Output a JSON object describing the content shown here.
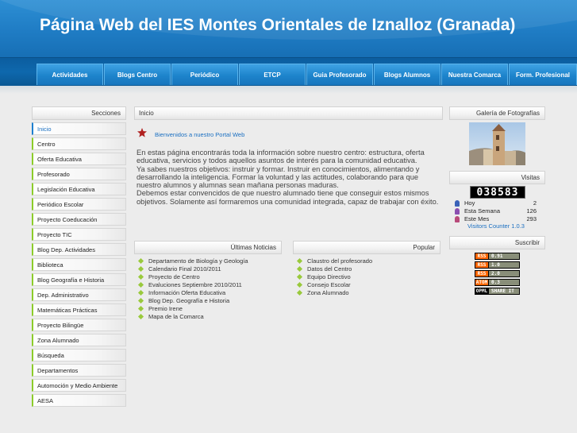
{
  "header": {
    "title": "Página Web del IES Montes Orientales de Iznalloz (Granada)"
  },
  "nav": [
    "Actividades",
    "Blogs Centro",
    "Periódico",
    "ETCP",
    "Guia Profesorado",
    "Blogs Alumnos",
    "Nuestra Comarca",
    "Form. Profesional"
  ],
  "sidebar": {
    "title": "Secciones",
    "items": [
      "Inicio",
      "Centro",
      "Oferta Educativa",
      "Profesorado",
      "Legislación Educativa",
      "Periódico Escolar",
      "Proyecto Coeducación",
      "Proyecto TIC",
      "Blog Dep. Actividades",
      "Biblioteca",
      "Blog Geografía e Historia",
      "Dep. Administrativo",
      "Matemáticas Prácticas",
      "Proyecto Bilingüe",
      "Zona Alumnado",
      "Búsqueda",
      "Departamentos",
      "Automoción y Medio Ambiente",
      "AESA"
    ]
  },
  "main": {
    "breadcrumb": "Inicio",
    "welcome": "Bienvenidos a nuestro Portal Web",
    "paragraphs": [
      "En estas página encontrarás toda la información sobre nuestro centro: estructura, oferta educativa, servicios y todos aquellos asuntos de interés para la comunidad educativa.",
      "Ya sabes nuestros objetivos: instruir y formar. Instruir en conocimientos, alimentando y desarrollando la inteligencia. Formar la voluntad y las actitudes, colaborando para que nuestro alumnos y alumnas sean mañana personas maduras.",
      "Debemos estar convencidos de que nuestro alumnado tiene que conseguir estos mismos objetivos. Solamente así formaremos una comunidad integrada, capaz de trabajar con éxito."
    ]
  },
  "news": {
    "title": "Últimas Noticias",
    "items": [
      "Departamento de Biología y Geología",
      "Calendario Final 2010/2011",
      "Proyecto de Centro",
      "Evaluciones Septiembre 2010/2011",
      "Información Oferta Educativa",
      "Blog Dep. Geografía e Historia",
      "Premio Irene",
      "Mapa de la Comarca"
    ]
  },
  "popular": {
    "title": "Popular",
    "items": [
      "Claustro del profesorado",
      "Datos del Centro",
      "Equipo Directivo",
      "Consejo Escolar",
      "Zona Alumnado"
    ]
  },
  "gallery": {
    "title": "Galería de Fotografías"
  },
  "visits": {
    "title": "Visitas",
    "counter": "038583",
    "rows": [
      {
        "label": "Hoy",
        "value": "2",
        "icon": "user-blue-icon",
        "color": "#3a62b8"
      },
      {
        "label": "Esta Semana",
        "value": "126",
        "icon": "user-purple-icon",
        "color": "#8a4fb0"
      },
      {
        "label": "Este Mes",
        "value": "293",
        "icon": "user-red-icon",
        "color": "#b84a7a"
      }
    ],
    "link": "Visitors Counter 1.0.3"
  },
  "subscribe": {
    "title": "Suscribir",
    "badges": [
      {
        "left": "RSS",
        "right": "0.91",
        "color": "#ff6600"
      },
      {
        "left": "RSS",
        "right": "1.0",
        "color": "#ff6600"
      },
      {
        "left": "RSS",
        "right": "2.0",
        "color": "#ff6600"
      },
      {
        "left": "ATOM",
        "right": "0.3",
        "color": "#ff6600"
      },
      {
        "left": "OPML",
        "right": "SHARE IT",
        "color": "#000000"
      }
    ]
  },
  "colors": {
    "header_blue": "#2088cd",
    "accent_green": "#8ccc2a",
    "link_blue": "#1a6fc1"
  }
}
